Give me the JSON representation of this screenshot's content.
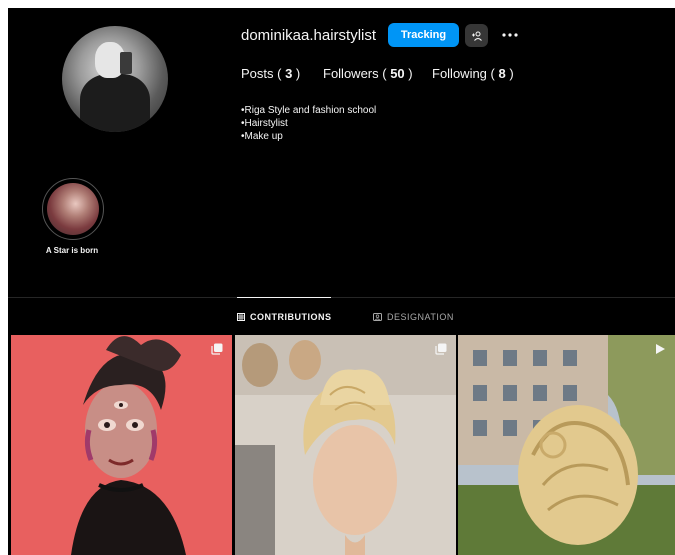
{
  "profile": {
    "username": "dominikaa.hairstylist",
    "track_button": "Tracking",
    "icons": {
      "add_user": "person-add-icon",
      "more": "more-options-icon"
    }
  },
  "stats": {
    "posts_label": "Posts",
    "posts_count": "3",
    "followers_label": "Followers",
    "followers_count": "50",
    "following_label": "Following",
    "following_count": "8"
  },
  "bio": [
    "•Riga Style and fashion school",
    "•Hairstylist",
    "•Make up"
  ],
  "highlight": {
    "label": "A Star is born"
  },
  "tabs": [
    {
      "label": "CONTRIBUTIONS",
      "icon": "grid-icon",
      "active": true
    },
    {
      "label": "DESIGNATION",
      "icon": "tagged-user-icon",
      "active": false
    }
  ],
  "posts": [
    {
      "type": "carousel",
      "icon": "carousel-icon"
    },
    {
      "type": "carousel",
      "icon": "carousel-icon"
    },
    {
      "type": "reel",
      "icon": "play-icon"
    }
  ],
  "colors": {
    "accent": "#0095f6",
    "background": "#000000",
    "text": "#f5f5f5",
    "muted": "#a8a8a8"
  }
}
